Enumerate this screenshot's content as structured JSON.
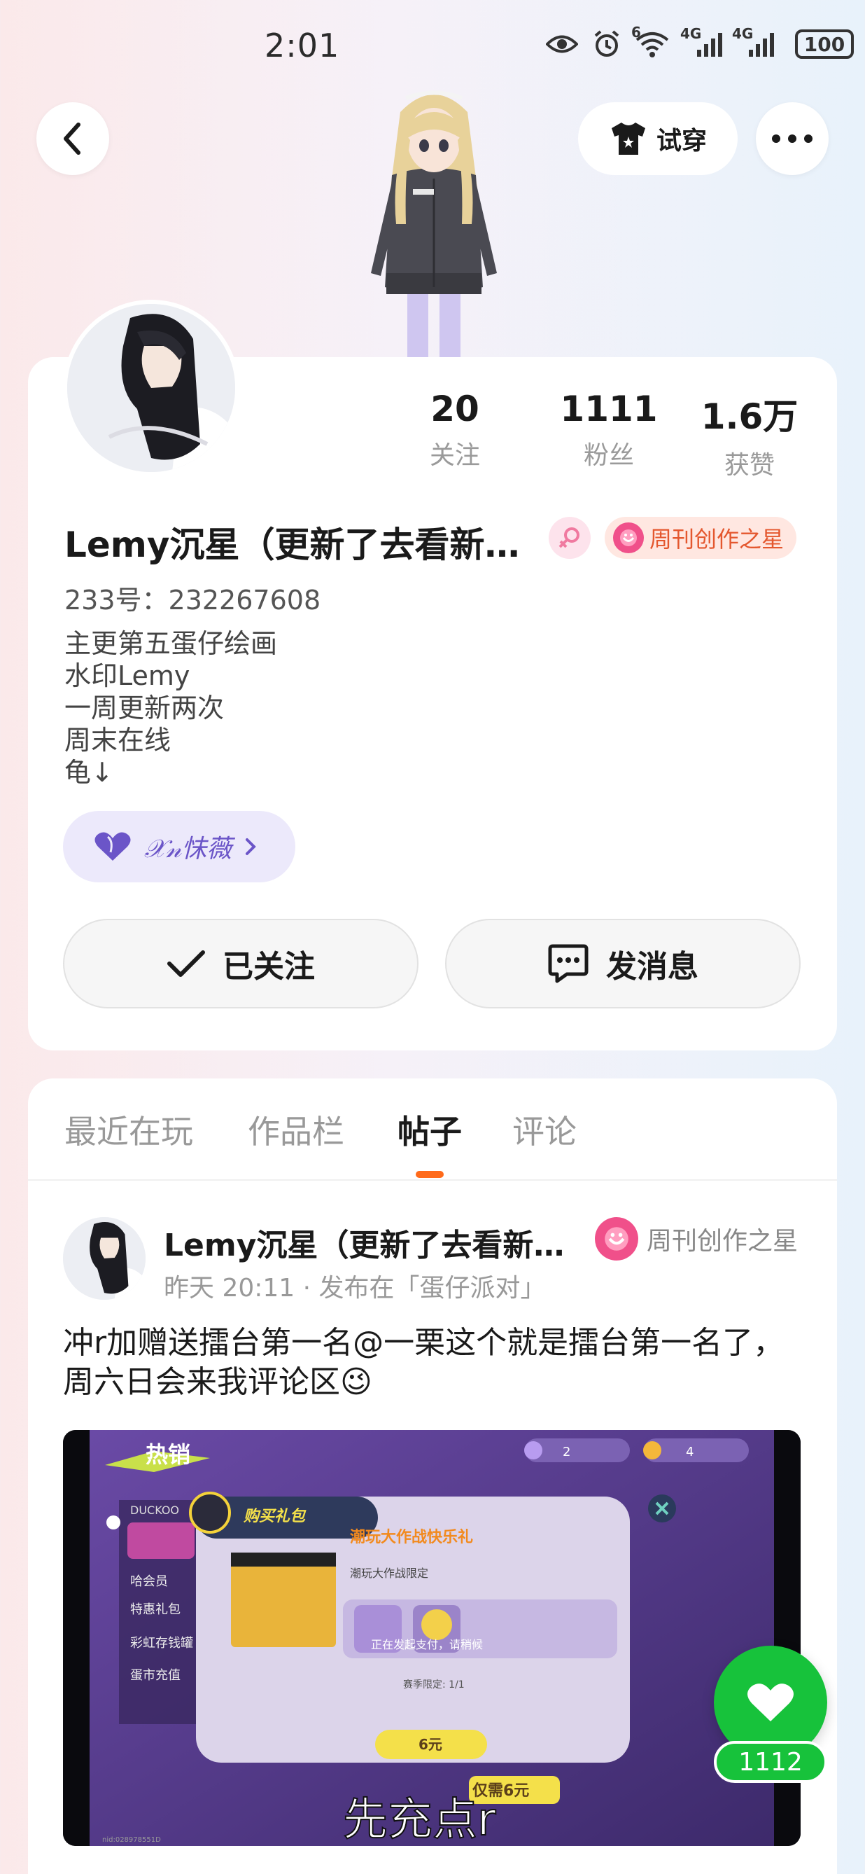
{
  "status_bar": {
    "time": "2:01",
    "signal_label_1": "4G",
    "signal_label_2": "4G",
    "wifi_label": "6",
    "battery": "100"
  },
  "header": {
    "try_on_label": "试穿"
  },
  "profile": {
    "stats": [
      {
        "value": "20",
        "label": "关注"
      },
      {
        "value": "1111",
        "label": "粉丝"
      },
      {
        "value": "1.6万",
        "label": "获赞"
      }
    ],
    "username": "Lemy沉星（更新了去看新…",
    "creator_badge": "周刊创作之星",
    "uid": "233号：232267608",
    "bio_lines": [
      "主更第五蛋仔绘画",
      "水印Lemy",
      "一周更新两次",
      "周末在线",
      "龟↓"
    ],
    "guild_chip": "𝒳𝓃怽薇",
    "follow_label": "已关注",
    "message_label": "发消息"
  },
  "tabs": [
    "最近在玩",
    "作品栏",
    "帖子",
    "评论"
  ],
  "active_tab": "帖子",
  "post": {
    "author": "Lemy沉星（更新了去看新…",
    "badge": "周刊创作之星",
    "meta": "昨天 20:11 · 发布在「蛋仔派对」",
    "text": "冲r加赠送擂台第一名@一栗这个就是擂台第一名了，周六日会来我评论区😉",
    "image": {
      "corner_title": "热销",
      "dialog_header": "购买礼包",
      "gift_title": "潮玩大作战快乐礼",
      "gift_sub": "潮玩大作战限定",
      "menu_items": [
        "DUCKOO",
        "哈会员",
        "特惠礼包",
        "彩虹存钱罐",
        "蛋市充值"
      ],
      "paying_text": "正在发起支付，请稍候",
      "season_limit": "赛季限定: 1/1",
      "price_button": "6元",
      "price_banner": "仅需6元",
      "caption": "先充点r",
      "currency_1": "2",
      "currency_2": "4",
      "watermark": "nid:028978551D"
    }
  },
  "like": {
    "count": "1112"
  },
  "colors": {
    "accent": "#ff6a1a",
    "like_green": "#17c23b",
    "badge_orange": "#e4572e",
    "guild_purple": "#6b55c8"
  }
}
